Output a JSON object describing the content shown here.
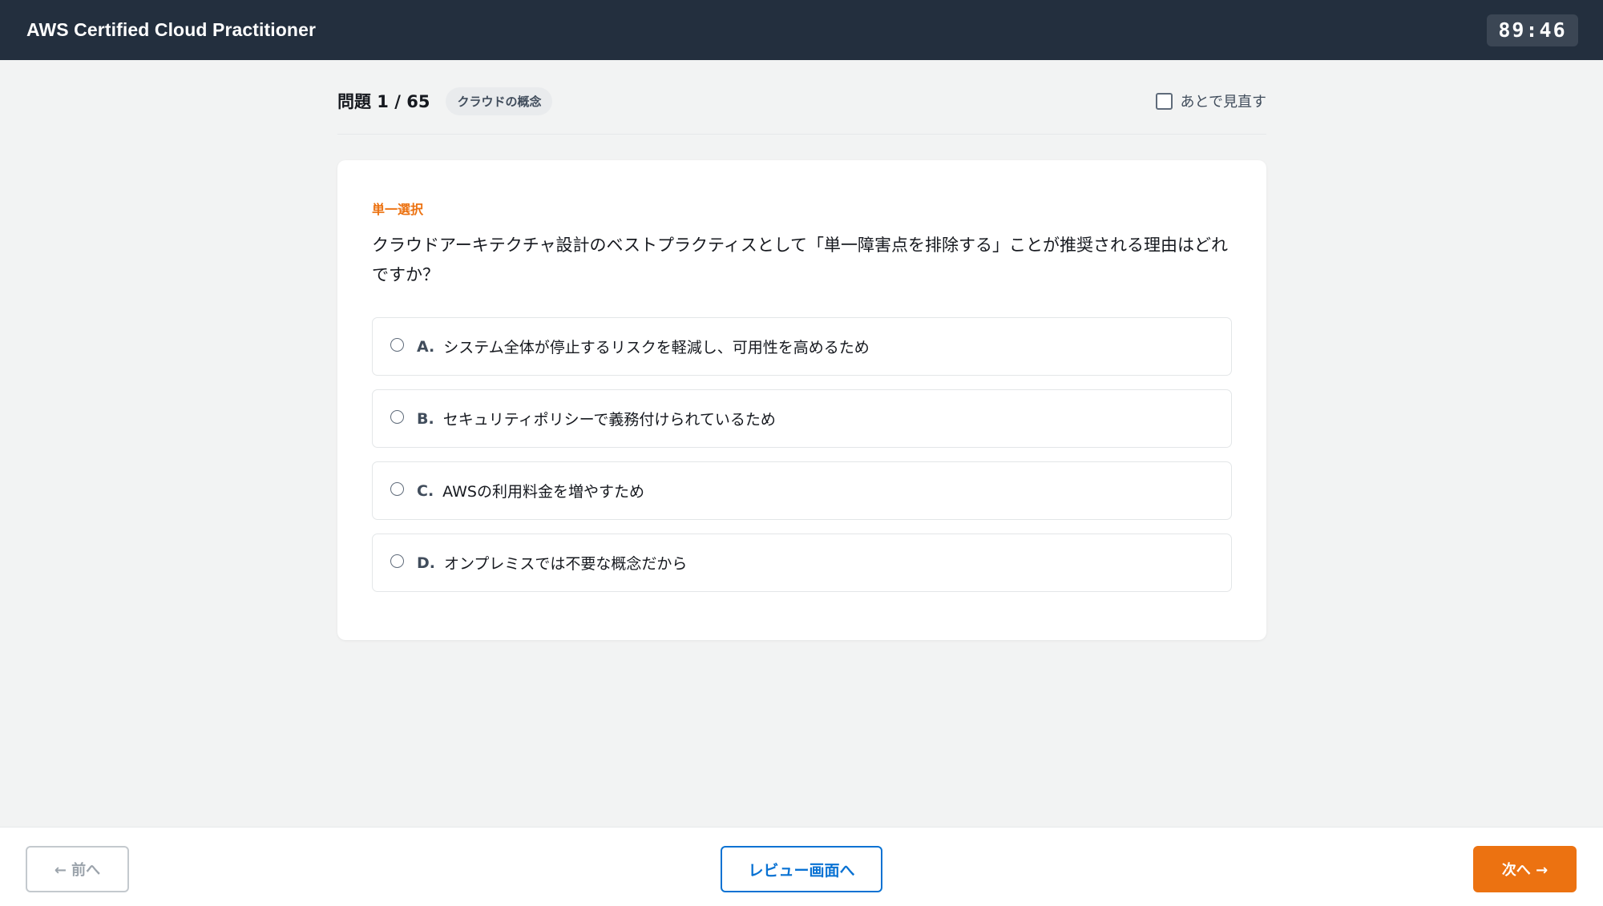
{
  "header": {
    "app_title": "AWS Certified Cloud Practitioner",
    "timer": "89:46"
  },
  "question_header": {
    "number_label": "問題 1 / 65",
    "category": "クラウドの概念",
    "review_flag_label": "あとで見直す",
    "review_flag_checked": false
  },
  "question": {
    "type_label": "単一選択",
    "text": "クラウドアーキテクチャ設計のベストプラクティスとして「単一障害点を排除する」ことが推奨される理由はどれですか？",
    "options": [
      {
        "letter": "A.",
        "text": "システム全体が停止するリスクを軽減し、可用性を高めるため"
      },
      {
        "letter": "B.",
        "text": "セキュリティポリシーで義務付けられているため"
      },
      {
        "letter": "C.",
        "text": "AWSの利用料金を増やすため"
      },
      {
        "letter": "D.",
        "text": "オンプレミスでは不要な概念だから"
      }
    ]
  },
  "footer": {
    "prev_label": "← 前へ",
    "review_label": "レビュー画面へ",
    "next_label": "次へ →"
  },
  "colors": {
    "header_bg": "#232f3e",
    "accent_orange": "#ec7211",
    "link_blue": "#0972d3",
    "page_bg": "#f2f3f3"
  }
}
